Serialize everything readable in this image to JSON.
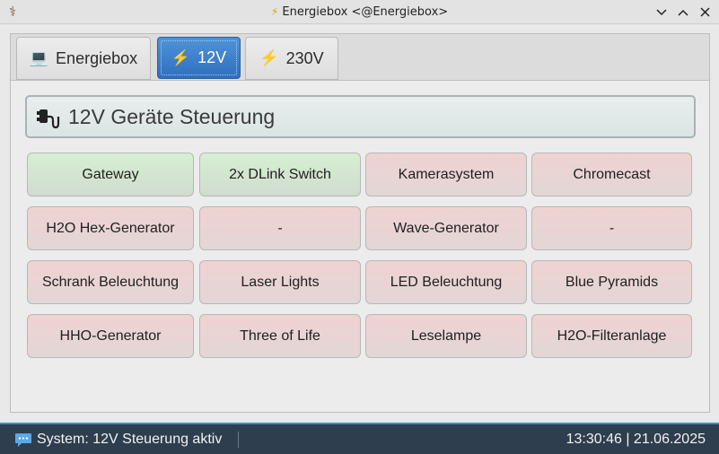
{
  "window": {
    "title": "Energiebox <@Energiebox>",
    "app_icon": "caduceus-icon"
  },
  "tabs": [
    {
      "label": "Energiebox",
      "icon": "laptop-icon",
      "active": false
    },
    {
      "label": "12V",
      "icon": "lightning-icon",
      "active": true
    },
    {
      "label": "230V",
      "icon": "lightning-icon",
      "active": false
    }
  ],
  "panel": {
    "title": "12V Geräte Steuerung",
    "icon": "plug-icon"
  },
  "devices": [
    {
      "label": "Gateway",
      "state": "on"
    },
    {
      "label": "2x DLink Switch",
      "state": "on"
    },
    {
      "label": "Kamerasystem",
      "state": "off"
    },
    {
      "label": "Chromecast",
      "state": "off"
    },
    {
      "label": "H2O Hex-Generator",
      "state": "off"
    },
    {
      "label": "-",
      "state": "off"
    },
    {
      "label": "Wave-Generator",
      "state": "off"
    },
    {
      "label": "-",
      "state": "off"
    },
    {
      "label": "Schrank Beleuchtung",
      "state": "off"
    },
    {
      "label": "Laser Lights",
      "state": "off"
    },
    {
      "label": "LED Beleuchtung",
      "state": "off"
    },
    {
      "label": "Blue Pyramids",
      "state": "off"
    },
    {
      "label": "HHO-Generator",
      "state": "off"
    },
    {
      "label": "Three of Life",
      "state": "off"
    },
    {
      "label": "Leselampe",
      "state": "off"
    },
    {
      "label": "H2O-Filteranlage",
      "state": "off"
    }
  ],
  "colors": {
    "on": "#d6efd1",
    "off": "#f0d2d2",
    "active_tab": "#3b7fcc",
    "statusbar": "#2e3e4e"
  },
  "statusbar": {
    "message": "System: 12V Steuerung aktiv",
    "message_icon": "speech-bubble-icon",
    "datetime": "13:30:46 | 21.06.2025"
  }
}
